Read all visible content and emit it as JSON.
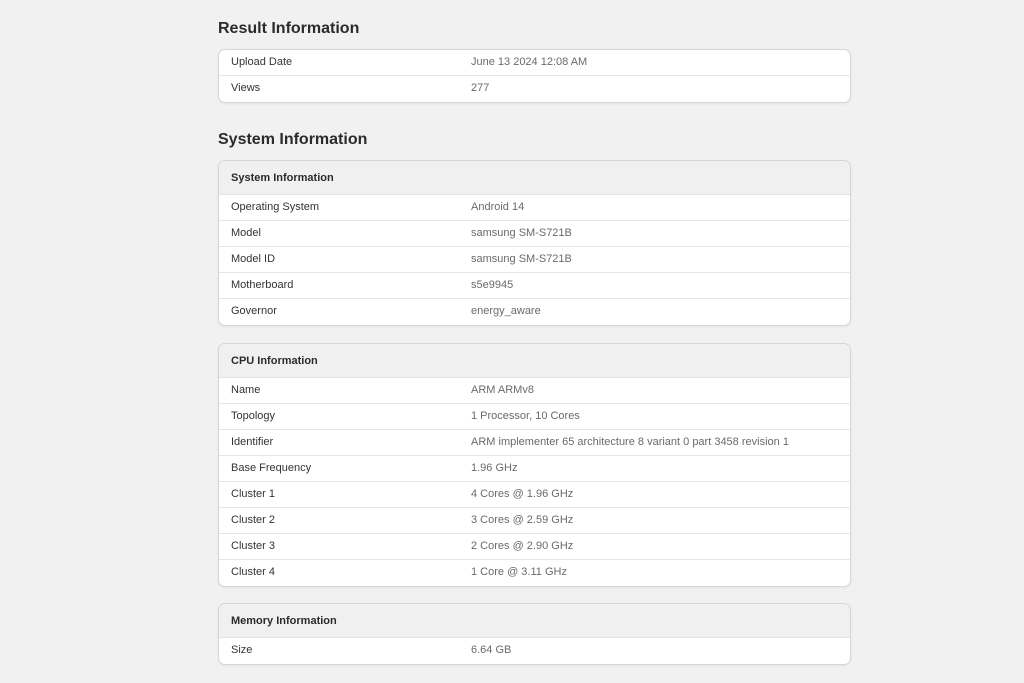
{
  "result": {
    "title": "Result Information",
    "rows": [
      {
        "label": "Upload Date",
        "value": "June 13 2024 12:08 AM"
      },
      {
        "label": "Views",
        "value": "277"
      }
    ]
  },
  "system": {
    "title": "System Information",
    "system_card": {
      "header": "System Information",
      "rows": [
        {
          "label": "Operating System",
          "value": "Android 14"
        },
        {
          "label": "Model",
          "value": "samsung SM-S721B"
        },
        {
          "label": "Model ID",
          "value": "samsung SM-S721B"
        },
        {
          "label": "Motherboard",
          "value": "s5e9945"
        },
        {
          "label": "Governor",
          "value": "energy_aware"
        }
      ]
    },
    "cpu_card": {
      "header": "CPU Information",
      "rows": [
        {
          "label": "Name",
          "value": "ARM ARMv8"
        },
        {
          "label": "Topology",
          "value": "1 Processor, 10 Cores"
        },
        {
          "label": "Identifier",
          "value": "ARM implementer 65 architecture 8 variant 0 part 3458 revision 1"
        },
        {
          "label": "Base Frequency",
          "value": "1.96 GHz"
        },
        {
          "label": "Cluster 1",
          "value": "4 Cores @ 1.96 GHz"
        },
        {
          "label": "Cluster 2",
          "value": "3 Cores @ 2.59 GHz"
        },
        {
          "label": "Cluster 3",
          "value": "2 Cores @ 2.90 GHz"
        },
        {
          "label": "Cluster 4",
          "value": "1 Core @ 3.11 GHz"
        }
      ]
    },
    "memory_card": {
      "header": "Memory Information",
      "rows": [
        {
          "label": "Size",
          "value": "6.64 GB"
        }
      ]
    }
  }
}
